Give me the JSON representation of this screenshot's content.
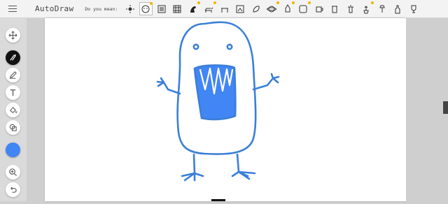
{
  "app": {
    "title": "AutoDraw"
  },
  "suggestions": {
    "label": "Do you mean:",
    "items": [
      {
        "name": "sun-icon",
        "starred": false
      },
      {
        "name": "face-icon",
        "starred": true,
        "selected": true
      },
      {
        "name": "monster-pattern-icon",
        "starred": false
      },
      {
        "name": "grid-icon",
        "starred": false
      },
      {
        "name": "bird-icon",
        "starred": true
      },
      {
        "name": "dog-icon",
        "starred": true
      },
      {
        "name": "table-icon",
        "starred": false
      },
      {
        "name": "frame-icon",
        "starred": false
      },
      {
        "name": "leaf-icon",
        "starred": false
      },
      {
        "name": "planet-icon",
        "starred": true
      },
      {
        "name": "rocket-icon",
        "starred": true
      },
      {
        "name": "square-icon",
        "starred": true
      },
      {
        "name": "mug-icon",
        "starred": false
      },
      {
        "name": "jar-icon",
        "starred": false
      },
      {
        "name": "trash-icon",
        "starred": false
      },
      {
        "name": "plant-pot-icon",
        "starred": true
      },
      {
        "name": "lamp-icon",
        "starred": false
      },
      {
        "name": "bottle-icon",
        "starred": false
      },
      {
        "name": "trophy-icon",
        "starred": false
      }
    ]
  },
  "toolbar": {
    "tools": [
      {
        "name": "move-tool",
        "icon": "move-icon"
      },
      {
        "name": "autodraw-tool",
        "icon": "autodraw-icon",
        "active": true
      },
      {
        "name": "draw-tool",
        "icon": "pencil-icon"
      },
      {
        "name": "type-tool",
        "icon": "text-icon"
      },
      {
        "name": "fill-tool",
        "icon": "fill-icon"
      },
      {
        "name": "shape-tool",
        "icon": "shape-icon"
      },
      {
        "name": "zoom-tool",
        "icon": "zoom-icon"
      },
      {
        "name": "undo-tool",
        "icon": "undo-icon"
      }
    ],
    "color": "#4285f4"
  },
  "drawing": {
    "stroke": "#3b7fd9",
    "fill": "#4285f4"
  }
}
